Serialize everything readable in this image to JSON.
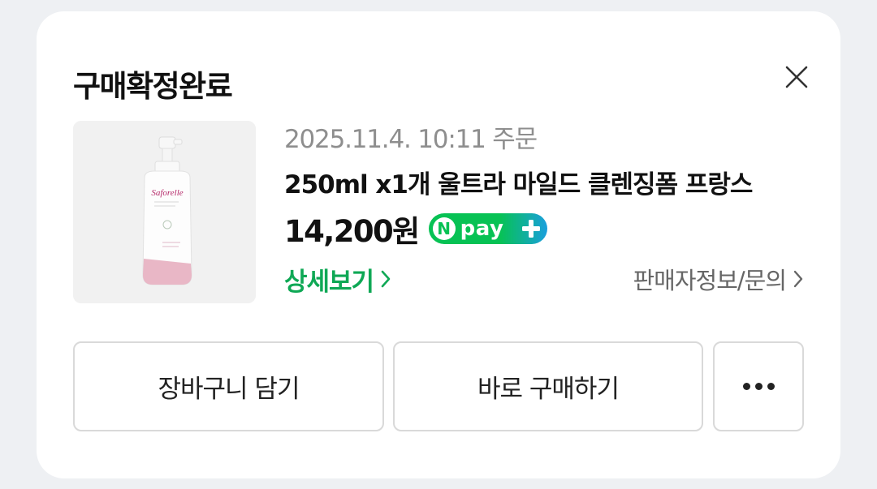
{
  "card": {
    "title": "구매확정완료"
  },
  "product": {
    "order_date": "2025.11.4. 10:11 주문",
    "name": "250ml x1개 울트라 마일드 클렌징폼 프랑스",
    "price": "14,200원",
    "image_brand": "Saforelle",
    "npay_badge": {
      "n": "N",
      "text": "pay"
    }
  },
  "links": {
    "detail": "상세보기",
    "seller_info": "판매자정보/문의"
  },
  "actions": {
    "cart": "장바구니 담기",
    "buy_now": "바로 구매하기"
  },
  "icons": {
    "close": "close-icon",
    "chevron": "chevron-right-icon",
    "more": "more-icon",
    "npay_plus": "plus-icon"
  },
  "colors": {
    "accent_green": "#0fa855",
    "npay_green": "#07c254",
    "npay_blue": "#1a9fdd",
    "date_gray": "#8e8e8e",
    "border": "#d9d9d9"
  }
}
